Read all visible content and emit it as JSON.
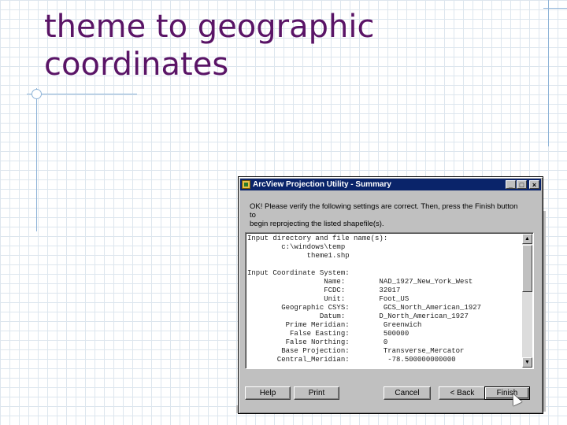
{
  "slide": {
    "title_line1": "theme to geographic",
    "title_line2": "coordinates"
  },
  "dialog": {
    "title": "ArcView Projection Utility - Summary",
    "window_buttons": {
      "minimize": "_",
      "maximize": "□",
      "close": "×"
    },
    "message_line1": "OK! Please verify the following settings are correct. Then, press the Finish button to",
    "message_line2": "begin reprojecting the listed shapefile(s).",
    "summary_lines": [
      "Input directory and file name(s):",
      "        c:\\windows\\temp",
      "              theme1.shp",
      "",
      "Input Coordinate System:",
      "                  Name:        NAD_1927_New_York_West",
      "                  FCDC:        32017",
      "                  Unit:        Foot_US",
      "        Geographic CSYS:        GCS_North_American_1927",
      "                 Datum:        D_North_American_1927",
      "         Prime Meridian:        Greenwich",
      "          False Easting:        500000",
      "         False Northing:        0",
      "        Base Projection:        Transverse_Mercator",
      "       Central_Meridian:         -78.500000000000"
    ],
    "buttons": {
      "help": "Help",
      "print": "Print",
      "cancel": "Cancel",
      "back": "< Back",
      "finish": "Finish"
    },
    "colors": {
      "titlebar": "#0a246a",
      "face": "#c0c0c0",
      "slide_title": "#5a1466"
    }
  }
}
